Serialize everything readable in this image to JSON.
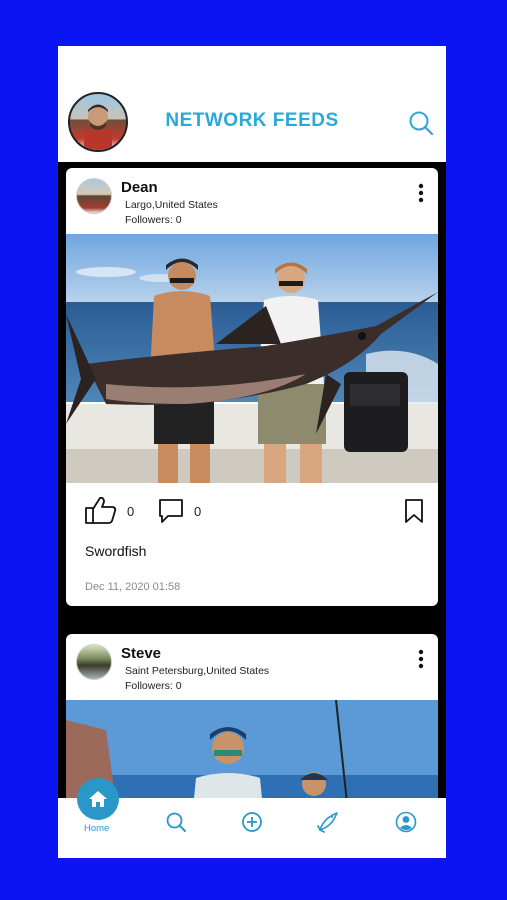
{
  "header": {
    "title": "NETWORK FEEDS",
    "avatar_icon": "user-avatar",
    "search_icon": "search-icon"
  },
  "posts": [
    {
      "name": "Dean",
      "location": "Largo,United States",
      "followers": "Followers: 0",
      "likes": "0",
      "comments": "0",
      "caption": "Swordfish",
      "timestamp": "Dec 11, 2020 01:58"
    },
    {
      "name": "Steve",
      "location": "Saint Petersburg,United States",
      "followers": "Followers: 0"
    }
  ],
  "tabbar": {
    "home_label": "Home",
    "tabs": [
      "home-icon",
      "search-icon",
      "add-icon",
      "fish-icon",
      "profile-icon"
    ]
  },
  "colors": {
    "background": "#0b14f2",
    "accent": "#2aa9d8",
    "tab_accent": "#2a97c9"
  }
}
